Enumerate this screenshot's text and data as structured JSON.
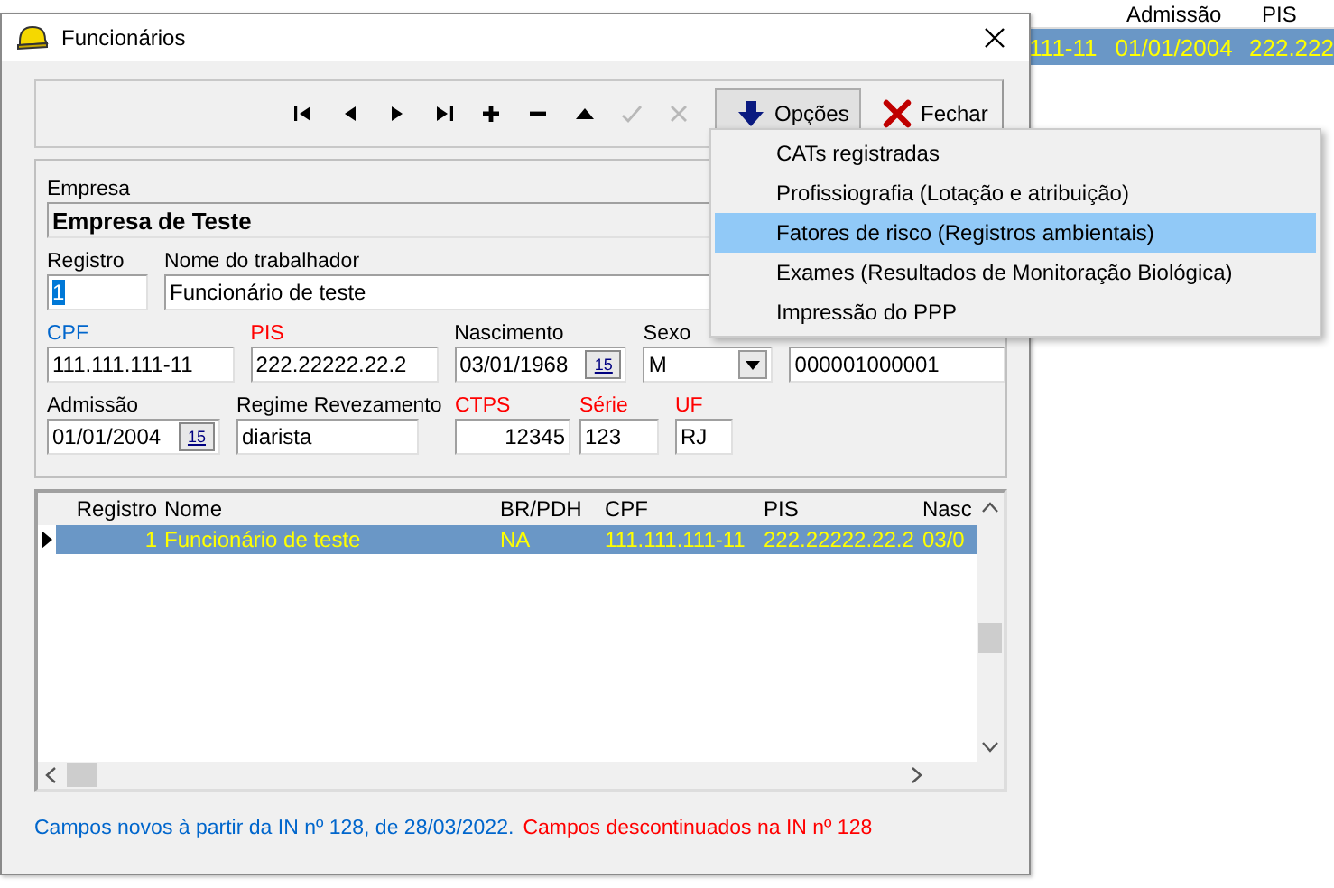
{
  "background_window": {
    "columns": [
      "Admissão",
      "PIS"
    ],
    "row": {
      "selected": true,
      "cells": [
        "111-11",
        "01/01/2004",
        "222.222"
      ]
    }
  },
  "window": {
    "title": "Funcionários"
  },
  "toolbar": {
    "nav_buttons": [
      {
        "kind": "first",
        "disabled": false
      },
      {
        "kind": "prev",
        "disabled": false
      },
      {
        "kind": "next",
        "disabled": false
      },
      {
        "kind": "last",
        "disabled": false
      },
      {
        "kind": "add",
        "disabled": false
      },
      {
        "kind": "remove",
        "disabled": false
      },
      {
        "kind": "up",
        "disabled": false
      },
      {
        "kind": "confirm",
        "disabled": true
      },
      {
        "kind": "cancel",
        "disabled": true
      }
    ],
    "options_button": "Opções",
    "close_button": "Fechar"
  },
  "form": {
    "fields": [
      {
        "label": "Empresa",
        "color": "#000000",
        "kind": "readonly",
        "value": "Empresa de Teste"
      },
      {
        "label": "Registro",
        "color": "#000000",
        "kind": "text",
        "value": "1",
        "value_selected": true
      },
      {
        "label": "Nome do trabalhador",
        "color": "#000000",
        "kind": "text",
        "value": "Funcionário de teste",
        "value_selected": false
      },
      {
        "label": "CPF",
        "color": "#0066cc",
        "kind": "text",
        "value": "111.111.111-11",
        "value_selected": false
      },
      {
        "label": "PIS",
        "color": "#ff0000",
        "kind": "text",
        "value": "222.22222.22.2",
        "value_selected": false
      },
      {
        "label": "Nascimento",
        "color": "#000000",
        "kind": "date",
        "value": "03/01/1968",
        "calendar": "15"
      },
      {
        "label": "Sexo",
        "color": "#000000",
        "kind": "select",
        "value": "M"
      },
      {
        "kind": "text",
        "value": "000001000001",
        "value_selected": false
      },
      {
        "label": "Admissão",
        "color": "#000000",
        "kind": "date",
        "value": "01/01/2004",
        "calendar": "15"
      },
      {
        "label": "Regime Revezamento",
        "color": "#000000",
        "kind": "text",
        "value": "diarista",
        "value_selected": false
      },
      {
        "label": "CTPS",
        "color": "#ff0000",
        "kind": "number",
        "value": "12345",
        "value_selected": false
      },
      {
        "label": "Série",
        "color": "#ff0000",
        "kind": "text",
        "value": "123",
        "value_selected": false
      },
      {
        "label": "UF",
        "color": "#ff0000",
        "kind": "text",
        "value": "RJ",
        "value_selected": false
      }
    ]
  },
  "table": {
    "columns": [
      "Registro",
      "Nome",
      "BR/PDH",
      "CPF",
      "PIS",
      "Nasc"
    ],
    "rows": [
      {
        "selected": true,
        "current": true,
        "cells": [
          "1",
          "Funcionário de teste",
          "NA",
          "111.111.111-11",
          "222.22222.22.2",
          "03/0"
        ]
      }
    ]
  },
  "legend": [
    {
      "color": "#0066cc",
      "text": "Campos novos à partir da IN nº 128, de 28/03/2022."
    },
    {
      "color": "#ff0000",
      "text": "Campos descontinuados na IN nº 128"
    }
  ],
  "options_menu": {
    "items": [
      {
        "label": "CATs registradas",
        "selected": false
      },
      {
        "label": "Profissiografia (Lotação e atribuição)",
        "selected": false
      },
      {
        "label": "Fatores de risco (Registros ambientais)",
        "selected": true
      },
      {
        "label": "Exames (Resultados de Monitoração Biológica)",
        "selected": false
      },
      {
        "label": "Impressão do PPP",
        "selected": false
      }
    ]
  }
}
